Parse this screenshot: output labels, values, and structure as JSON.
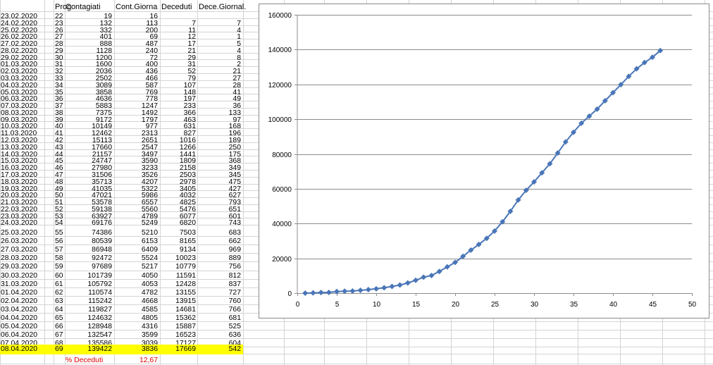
{
  "sheet": {
    "headers": {
      "col_b": "Prog",
      "col_c": "Contagiati",
      "col_d": "Cont.Giorna",
      "col_e": "Deceduti",
      "col_f": "Dece.Giornal."
    },
    "highlight_color": "#ffff00",
    "rows": [
      {
        "date": "23.02.2020",
        "prog": "22",
        "cont": "19",
        "cg": "16",
        "dec": "",
        "dg": ""
      },
      {
        "date": "24.02.2020",
        "prog": "23",
        "cont": "132",
        "cg": "113",
        "dec": "7",
        "dg": "7"
      },
      {
        "date": "25.02.2020",
        "prog": "26",
        "cont": "332",
        "cg": "200",
        "dec": "11",
        "dg": "4"
      },
      {
        "date": "26.02.2020",
        "prog": "27",
        "cont": "401",
        "cg": "69",
        "dec": "12",
        "dg": "1"
      },
      {
        "date": "27.02.2020",
        "prog": "28",
        "cont": "888",
        "cg": "487",
        "dec": "17",
        "dg": "5"
      },
      {
        "date": "28.02.2020",
        "prog": "29",
        "cont": "1128",
        "cg": "240",
        "dec": "21",
        "dg": "4"
      },
      {
        "date": "29.02.2020",
        "prog": "30",
        "cont": "1200",
        "cg": "72",
        "dec": "29",
        "dg": "8"
      },
      {
        "date": "01.03.2020",
        "prog": "31",
        "cont": "1600",
        "cg": "400",
        "dec": "31",
        "dg": "2"
      },
      {
        "date": "02.03.2020",
        "prog": "32",
        "cont": "2036",
        "cg": "436",
        "dec": "52",
        "dg": "21"
      },
      {
        "date": "03.03.2020",
        "prog": "33",
        "cont": "2502",
        "cg": "466",
        "dec": "79",
        "dg": "27"
      },
      {
        "date": "04.03.2020",
        "prog": "34",
        "cont": "3089",
        "cg": "587",
        "dec": "107",
        "dg": "28"
      },
      {
        "date": "05.03.2020",
        "prog": "35",
        "cont": "3858",
        "cg": "769",
        "dec": "148",
        "dg": "41"
      },
      {
        "date": "06.03.2020",
        "prog": "36",
        "cont": "4636",
        "cg": "778",
        "dec": "197",
        "dg": "49"
      },
      {
        "date": "07.03.2020",
        "prog": "37",
        "cont": "5883",
        "cg": "1247",
        "dec": "233",
        "dg": "36"
      },
      {
        "date": "08.03.2020",
        "prog": "38",
        "cont": "7375",
        "cg": "1492",
        "dec": "366",
        "dg": "133"
      },
      {
        "date": "09.03.2020",
        "prog": "39",
        "cont": "9172",
        "cg": "1797",
        "dec": "463",
        "dg": "97"
      },
      {
        "date": "10.03.2020",
        "prog": "40",
        "cont": "10149",
        "cg": "977",
        "dec": "631",
        "dg": "168"
      },
      {
        "date": "11.03.2020",
        "prog": "41",
        "cont": "12462",
        "cg": "2313",
        "dec": "827",
        "dg": "196"
      },
      {
        "date": "12.03.2020",
        "prog": "42",
        "cont": "15113",
        "cg": "2651",
        "dec": "1016",
        "dg": "189"
      },
      {
        "date": "13.03.2020",
        "prog": "43",
        "cont": "17660",
        "cg": "2547",
        "dec": "1266",
        "dg": "250"
      },
      {
        "date": "14.03.2020",
        "prog": "44",
        "cont": "21157",
        "cg": "3497",
        "dec": "1441",
        "dg": "175"
      },
      {
        "date": "15.03.2020",
        "prog": "45",
        "cont": "24747",
        "cg": "3590",
        "dec": "1809",
        "dg": "368"
      },
      {
        "date": "16.03.2020",
        "prog": "46",
        "cont": "27980",
        "cg": "3233",
        "dec": "2158",
        "dg": "349"
      },
      {
        "date": "17.03.2020",
        "prog": "47",
        "cont": "31506",
        "cg": "3526",
        "dec": "2503",
        "dg": "345"
      },
      {
        "date": "18.03.2020",
        "prog": "48",
        "cont": "35713",
        "cg": "4207",
        "dec": "2978",
        "dg": "475"
      },
      {
        "date": "19.03.2020",
        "prog": "49",
        "cont": "41035",
        "cg": "5322",
        "dec": "3405",
        "dg": "427"
      },
      {
        "date": "20.03.2020",
        "prog": "50",
        "cont": "47021",
        "cg": "5986",
        "dec": "4032",
        "dg": "627"
      },
      {
        "date": "21.03.2020",
        "prog": "51",
        "cont": "53578",
        "cg": "6557",
        "dec": "4825",
        "dg": "793"
      },
      {
        "date": "22.03.2020",
        "prog": "52",
        "cont": "59138",
        "cg": "5560",
        "dec": "5476",
        "dg": "651"
      },
      {
        "date": "23.03.2020",
        "prog": "53",
        "cont": "63927",
        "cg": "4789",
        "dec": "6077",
        "dg": "601"
      },
      {
        "date": "24.03.2020",
        "prog": "54",
        "cont": "69176",
        "cg": "5249",
        "dec": "6820",
        "dg": "743"
      },
      {
        "date": "25.03.2020",
        "prog": "55",
        "cont": "74386",
        "cg": "5210",
        "dec": "7503",
        "dg": "683"
      },
      {
        "date": "26.03.2020",
        "prog": "56",
        "cont": "80539",
        "cg": "6153",
        "dec": "8165",
        "dg": "662"
      },
      {
        "date": "27.03.2020",
        "prog": "57",
        "cont": "86948",
        "cg": "6409",
        "dec": "9134",
        "dg": "969"
      },
      {
        "date": "28.03.2020",
        "prog": "58",
        "cont": "92472",
        "cg": "5524",
        "dec": "10023",
        "dg": "889"
      },
      {
        "date": "29.03.2020",
        "prog": "59",
        "cont": "97689",
        "cg": "5217",
        "dec": "10779",
        "dg": "756"
      },
      {
        "date": "30.03.2020",
        "prog": "60",
        "cont": "101739",
        "cg": "4050",
        "dec": "11591",
        "dg": "812"
      },
      {
        "date": "31.03.2020",
        "prog": "61",
        "cont": "105792",
        "cg": "4053",
        "dec": "12428",
        "dg": "837"
      },
      {
        "date": "01.04.2020",
        "prog": "62",
        "cont": "110574",
        "cg": "4782",
        "dec": "13155",
        "dg": "727"
      },
      {
        "date": "02.04.2020",
        "prog": "63",
        "cont": "115242",
        "cg": "4668",
        "dec": "13915",
        "dg": "760"
      },
      {
        "date": "03.04.2020",
        "prog": "64",
        "cont": "119827",
        "cg": "4585",
        "dec": "14681",
        "dg": "766"
      },
      {
        "date": "04.04.2020",
        "prog": "65",
        "cont": "124632",
        "cg": "4805",
        "dec": "15362",
        "dg": "681"
      },
      {
        "date": "05.04.2020",
        "prog": "66",
        "cont": "128948",
        "cg": "4316",
        "dec": "15887",
        "dg": "525"
      },
      {
        "date": "06.04.2020",
        "prog": "67",
        "cont": "132547",
        "cg": "3599",
        "dec": "16523",
        "dg": "636"
      },
      {
        "date": "07.04.2020",
        "prog": "68",
        "cont": "135586",
        "cg": "3039",
        "dec": "17127",
        "dg": "604"
      },
      {
        "date": "08.04.2020",
        "prog": "69",
        "cont": "139422",
        "cg": "3836",
        "dec": "17669",
        "dg": "542"
      }
    ],
    "footer": {
      "label": "% Deceduti",
      "value": "12,67",
      "color": "#e00000"
    }
  },
  "chart_data": {
    "type": "line",
    "title": "",
    "xlabel": "",
    "ylabel": "",
    "xlim": [
      0,
      50
    ],
    "ylim": [
      0,
      160000
    ],
    "x_ticks": [
      "0",
      "5",
      "10",
      "15",
      "20",
      "25",
      "30",
      "35",
      "40",
      "45",
      "50"
    ],
    "y_ticks": [
      "0",
      "20000",
      "40000",
      "60000",
      "80000",
      "100000",
      "120000",
      "140000",
      "160000"
    ],
    "grid": "horizontal",
    "legend": "none",
    "series_color": "#4a76b8",
    "series": [
      {
        "x": [
          1,
          2,
          3,
          4,
          5,
          6,
          7,
          8,
          9,
          10,
          11,
          12,
          13,
          14,
          15,
          16,
          17,
          18,
          19,
          20,
          21,
          22,
          23,
          24,
          25,
          26,
          27,
          28,
          29,
          30,
          31,
          32,
          33,
          34,
          35,
          36,
          37,
          38,
          39,
          40,
          41,
          42,
          43,
          44,
          45,
          46
        ],
        "values": [
          19,
          132,
          332,
          401,
          888,
          1128,
          1200,
          1600,
          2036,
          2502,
          3089,
          3858,
          4636,
          5883,
          7375,
          9172,
          10149,
          12462,
          15113,
          17660,
          21157,
          24747,
          27980,
          31506,
          35713,
          41035,
          47021,
          53578,
          59138,
          63927,
          69176,
          74386,
          80539,
          86948,
          92472,
          97689,
          101739,
          105792,
          110574,
          115242,
          119827,
          124632,
          128948,
          132547,
          135586,
          139422
        ]
      }
    ]
  }
}
